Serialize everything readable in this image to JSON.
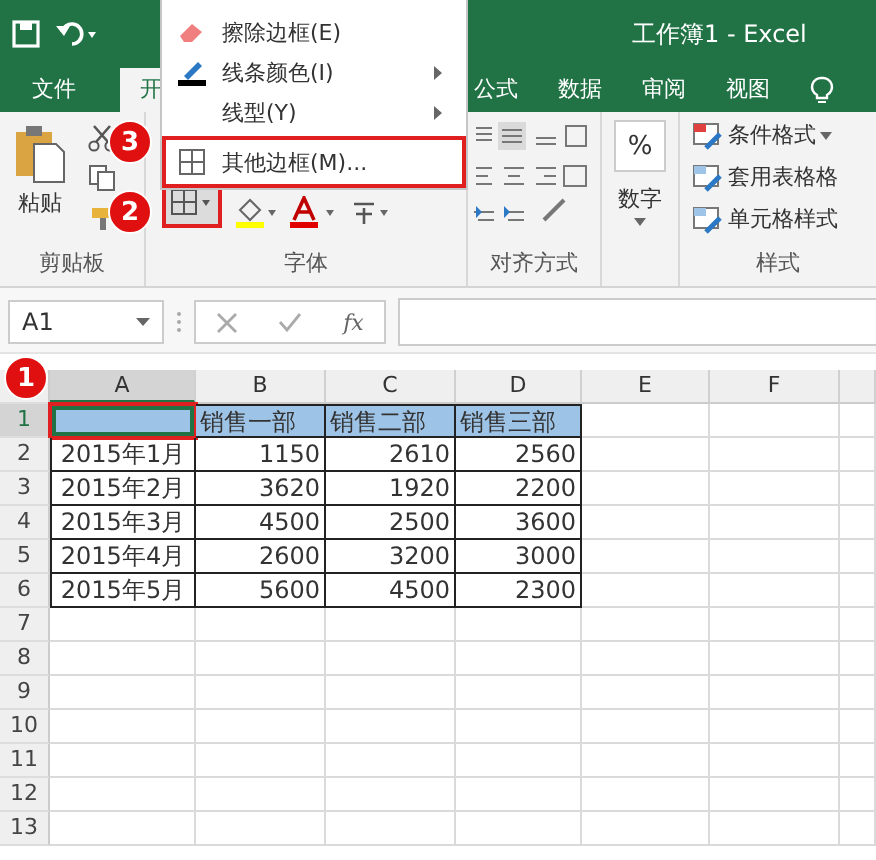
{
  "title_bar": {
    "title": "工作簿1 - Excel"
  },
  "tabs": [
    {
      "label": "文件",
      "selected": false
    },
    {
      "label": "开",
      "selected": true
    },
    {
      "label": "公式",
      "selected": false
    },
    {
      "label": "数据",
      "selected": false
    },
    {
      "label": "审阅",
      "selected": false
    },
    {
      "label": "视图",
      "selected": false
    }
  ],
  "ribbon": {
    "clipboard": {
      "paste_label": "粘贴",
      "label": "剪贴板"
    },
    "font": {
      "label": "字体",
      "border_button_highlighted": true
    },
    "alignment": {
      "label": "对齐方式"
    },
    "number": {
      "symbol": "%",
      "button_label": "数字"
    },
    "styles": {
      "items": [
        {
          "label": "条件格式",
          "dropdown": true
        },
        {
          "label": "套用表格格",
          "dropdown": false
        },
        {
          "label": "单元格样式",
          "dropdown": false
        }
      ],
      "label": "样式"
    }
  },
  "border_menu": {
    "items": [
      {
        "label": "擦除边框(E)",
        "kind": "eraser",
        "submenu": false,
        "highlighted": false
      },
      {
        "label": "线条颜色(I)",
        "kind": "pen",
        "submenu": true,
        "highlighted": false
      },
      {
        "label": "线型(Y)",
        "kind": "none",
        "submenu": true,
        "highlighted": false
      },
      {
        "label": "其他边框(M)...",
        "kind": "grid",
        "submenu": false,
        "highlighted": true
      }
    ]
  },
  "formula_bar": {
    "name_box": "A1",
    "function_label": "fx"
  },
  "sheet": {
    "columns": [
      {
        "label": "A",
        "selected": true
      },
      {
        "label": "B",
        "selected": false
      },
      {
        "label": "C",
        "selected": false
      },
      {
        "label": "D",
        "selected": false
      },
      {
        "label": "E",
        "selected": false
      },
      {
        "label": "F",
        "selected": false
      }
    ],
    "rows": [
      {
        "number": "1",
        "selected": true,
        "kind": "header",
        "cells": [
          "",
          "销售一部",
          "销售二部",
          "销售三部"
        ]
      },
      {
        "number": "2",
        "selected": false,
        "kind": "data",
        "cells": [
          "2015年1月",
          "1150",
          "2610",
          "2560"
        ]
      },
      {
        "number": "3",
        "selected": false,
        "kind": "data",
        "cells": [
          "2015年2月",
          "3620",
          "1920",
          "2200"
        ]
      },
      {
        "number": "4",
        "selected": false,
        "kind": "data",
        "cells": [
          "2015年3月",
          "4500",
          "2500",
          "3600"
        ]
      },
      {
        "number": "5",
        "selected": false,
        "kind": "data",
        "cells": [
          "2015年4月",
          "2600",
          "3200",
          "3000"
        ]
      },
      {
        "number": "6",
        "selected": false,
        "kind": "data",
        "cells": [
          "2015年5月",
          "5600",
          "4500",
          "2300"
        ]
      },
      {
        "number": "7",
        "selected": false,
        "kind": "empty",
        "cells": []
      },
      {
        "number": "8",
        "selected": false,
        "kind": "empty",
        "cells": []
      },
      {
        "number": "9",
        "selected": false,
        "kind": "empty",
        "cells": []
      },
      {
        "number": "10",
        "selected": false,
        "kind": "empty",
        "cells": []
      },
      {
        "number": "11",
        "selected": false,
        "kind": "empty",
        "cells": []
      },
      {
        "number": "12",
        "selected": false,
        "kind": "empty",
        "cells": []
      },
      {
        "number": "13",
        "selected": false,
        "kind": "empty",
        "cells": []
      }
    ]
  },
  "callouts": [
    {
      "number": "1"
    },
    {
      "number": "2"
    },
    {
      "number": "3"
    }
  ]
}
